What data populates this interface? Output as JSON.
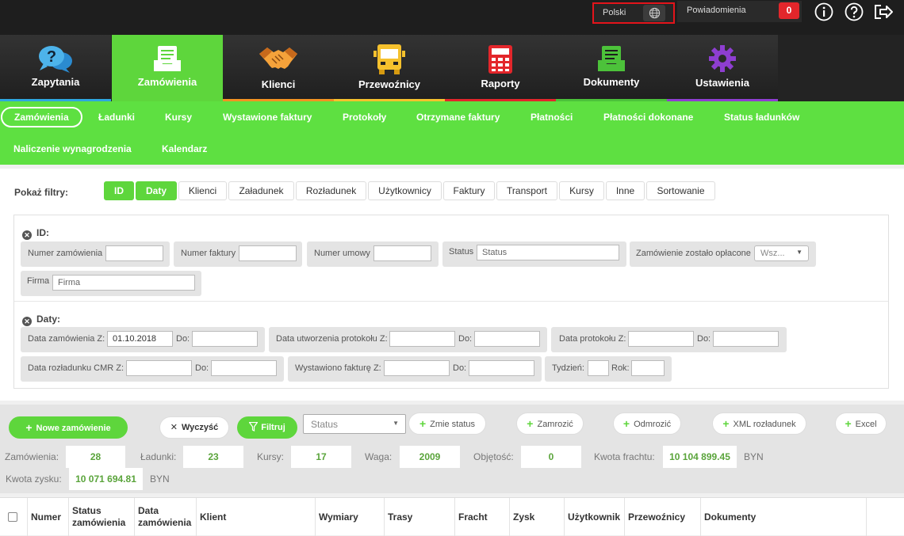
{
  "topbar": {
    "language": "Polski",
    "notifications_label": "Powiadomienia",
    "notifications_count": "0"
  },
  "main_nav": [
    {
      "label": "Zapytania",
      "color": "#2ea7e0"
    },
    {
      "label": "Zamówienia",
      "color": "#5ed63c"
    },
    {
      "label": "Klienci",
      "color": "#f39222"
    },
    {
      "label": "Przewoźnicy",
      "color": "#f5c12d"
    },
    {
      "label": "Raporty",
      "color": "#e3262b"
    },
    {
      "label": "Dokumenty",
      "color": "#4cc23a"
    },
    {
      "label": "Ustawienia",
      "color": "#8e3ed1"
    }
  ],
  "sub_nav": [
    "Zamówienia",
    "Ładunki",
    "Kursy",
    "Wystawione faktury",
    "Protokoły",
    "Otrzymane faktury",
    "Płatności",
    "Płatności dokonane",
    "Status ładunków",
    "Naliczenie wynagrodzenia",
    "Kalendarz"
  ],
  "filters": {
    "label": "Pokaż filtry:",
    "buttons": [
      "ID",
      "Daty",
      "Klienci",
      "Załadunek",
      "Rozładunek",
      "Użytkownicy",
      "Faktury",
      "Transport",
      "Kursy",
      "Inne",
      "Sortowanie"
    ],
    "id_section": {
      "title": "ID:",
      "order_number": "Numer zamówienia",
      "invoice_number": "Numer faktury",
      "contract_number": "Numer umowy",
      "status": "Status",
      "status_placeholder": "Status",
      "paid": "Zamówienie zostało opłacone",
      "paid_value": "Wsz...",
      "company": "Firma",
      "company_placeholder": "Firma"
    },
    "dates_section": {
      "title": "Daty:",
      "order_date_from": "Data zamówienia Z:",
      "order_date_from_value": "01.10.2018",
      "to": "Do:",
      "protocol_created_from": "Data utworzenia protokołu Z:",
      "protocol_date_from": "Data protokołu Z:",
      "cmr_date_from": "Data rozładunku CMR Z:",
      "invoice_issued_from": "Wystawiono fakturę Z:",
      "week": "Tydzień:",
      "year": "Rok:"
    }
  },
  "toolbar": {
    "new_order": "Nowe zamówienie",
    "clear": "Wyczyść",
    "filter": "Filtruj",
    "status_select": "Status",
    "change_status": "Zmie status",
    "freeze": "Zamrozić",
    "unfreeze": "Odmrozić",
    "xml": "XML rozładunek",
    "excel": "Excel"
  },
  "stats": {
    "orders_label": "Zamówienia:",
    "orders": "28",
    "loads_label": "Ładunki:",
    "loads": "23",
    "courses_label": "Kursy:",
    "courses": "17",
    "weight_label": "Waga:",
    "weight": "2009",
    "volume_label": "Objętość:",
    "volume": "0",
    "freight_label": "Kwota frachtu:",
    "freight": "10 104 899.45",
    "currency": "BYN",
    "profit_label": "Kwota zysku:",
    "profit": "10 071 694.81",
    "currency2": "BYN"
  },
  "table": {
    "headers": [
      "Numer",
      "Status zamówienia",
      "Data zamówienia",
      "Klient",
      "Wymiary",
      "Trasy",
      "Fracht",
      "Zysk",
      "Użytkownik",
      "Przewoźnicy",
      "Dokumenty"
    ]
  }
}
